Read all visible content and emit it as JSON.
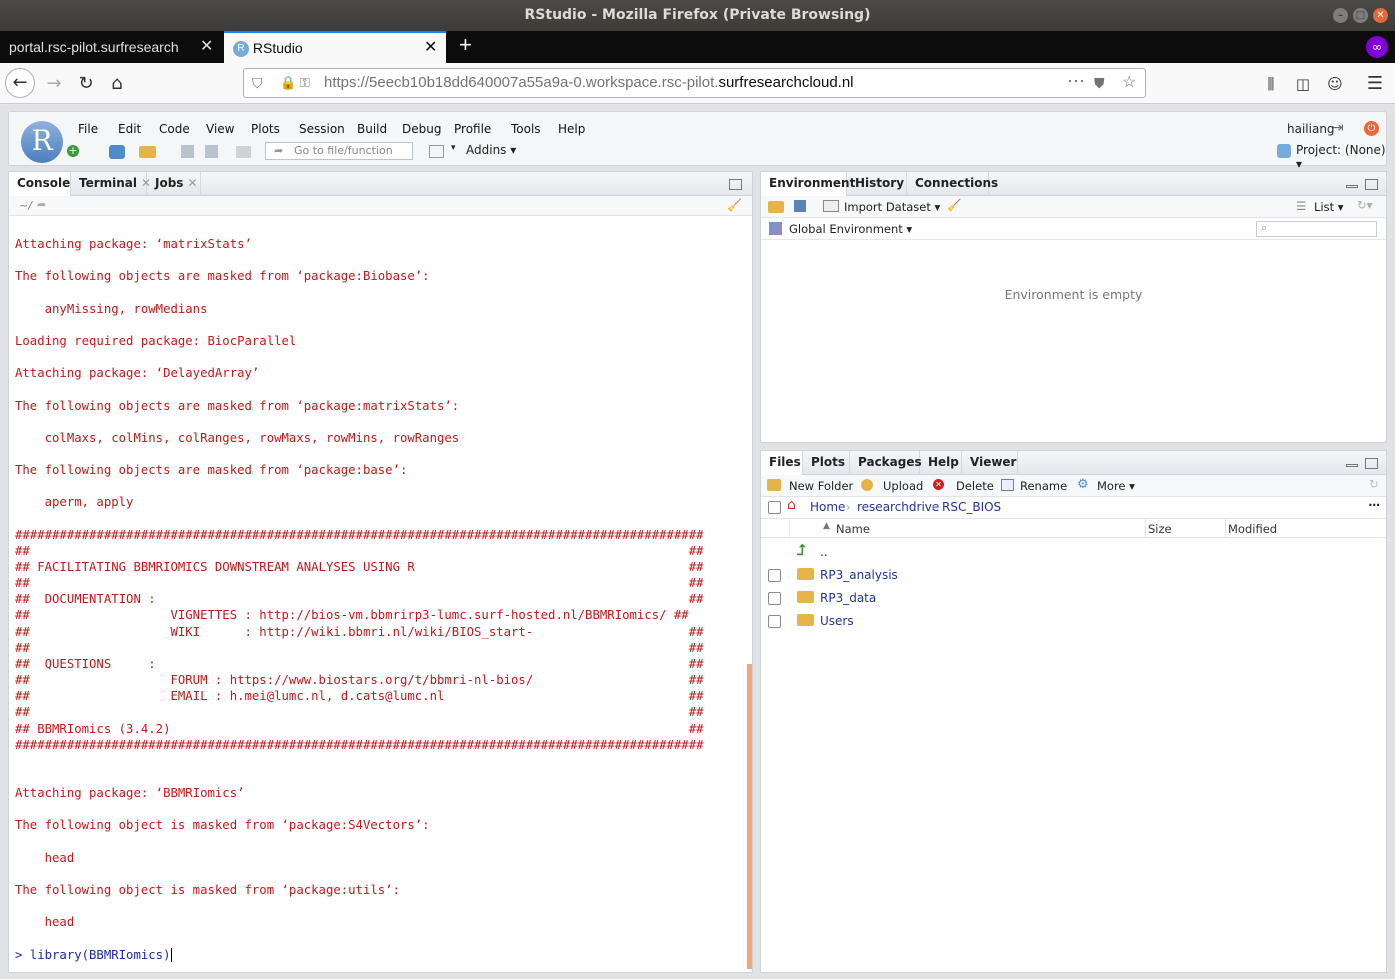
{
  "window": {
    "title": "RStudio - Mozilla Firefox (Private Browsing)"
  },
  "tabs": [
    {
      "label": "portal.rsc-pilot.surfresearch"
    },
    {
      "label": "RStudio"
    }
  ],
  "url": {
    "prefix": "https://5eecb10b18dd640007a55a9a-0.workspace.rsc-pilot.",
    "domain": "surfresearchcloud.nl"
  },
  "menu": [
    "File",
    "Edit",
    "Code",
    "View",
    "Plots",
    "Session",
    "Build",
    "Debug",
    "Profile",
    "Tools",
    "Help"
  ],
  "user": "hailiang",
  "toolbar": {
    "goto_placeholder": "Go to file/function",
    "addins": "Addins",
    "project": "Project: (None)"
  },
  "left_tabs": [
    "Console",
    "Terminal",
    "Jobs"
  ],
  "console_path": "~/",
  "console_lines": [
    "Attaching package: ‘matrixStats’",
    "",
    "The following objects are masked from ‘package:Biobase’:",
    "",
    "    anyMissing, rowMedians",
    "",
    "Loading required package: BiocParallel",
    "",
    "Attaching package: ‘DelayedArray’",
    "",
    "The following objects are masked from ‘package:matrixStats’:",
    "",
    "    colMaxs, colMins, colRanges, rowMaxs, rowMins, rowRanges",
    "",
    "The following objects are masked from ‘package:base’:",
    "",
    "    aperm, apply",
    "",
    "#############################################################################################",
    "##                                                                                         ##",
    "## FACILITATING BBMRIOMICS DOWNSTREAM ANALYSES USING R                                     ##",
    "##                                                                                         ##",
    "##  DOCUMENTATION :                                                                        ##",
    "##                   VIGNETTES : http://bios-vm.bbmrirp3-lumc.surf-hosted.nl/BBMRIomics/ ##",
    "##                   WIKI      : http://wiki.bbmri.nl/wiki/BIOS_start-                     ##",
    "##                                                                                         ##",
    "##  QUESTIONS     :                                                                        ##",
    "##                   FORUM : https://www.biostars.org/t/bbmri-nl-bios/                     ##",
    "##                   EMAIL : h.mei@lumc.nl, d.cats@lumc.nl                                 ##",
    "##                                                                                         ##",
    "## BBMRIomics (3.4.2)                                                                      ##",
    "#############################################################################################",
    "",
    "",
    "Attaching package: ‘BBMRIomics’",
    "",
    "The following object is masked from ‘package:S4Vectors’:",
    "",
    "    head",
    "",
    "The following object is masked from ‘package:utils’:",
    "",
    "    head",
    ""
  ],
  "console_prompt": "> library(BBMRIomics)",
  "env_tabs": [
    "Environment",
    "History",
    "Connections"
  ],
  "env": {
    "import_label": "Import Dataset",
    "list_label": "List",
    "global_env": "Global Environment",
    "empty_msg": "Environment is empty"
  },
  "files_tabs": [
    "Files",
    "Plots",
    "Packages",
    "Help",
    "Viewer"
  ],
  "files_toolbar": {
    "new_folder": "New Folder",
    "upload": "Upload",
    "delete": "Delete",
    "rename": "Rename",
    "more": "More"
  },
  "breadcrumb": [
    "Home",
    "researchdrive",
    "RSC_BIOS"
  ],
  "file_columns": {
    "name": "Name",
    "size": "Size",
    "modified": "Modified"
  },
  "files": [
    {
      "name": ".."
    },
    {
      "name": "RP3_analysis"
    },
    {
      "name": "RP3_data"
    },
    {
      "name": "Users"
    }
  ]
}
